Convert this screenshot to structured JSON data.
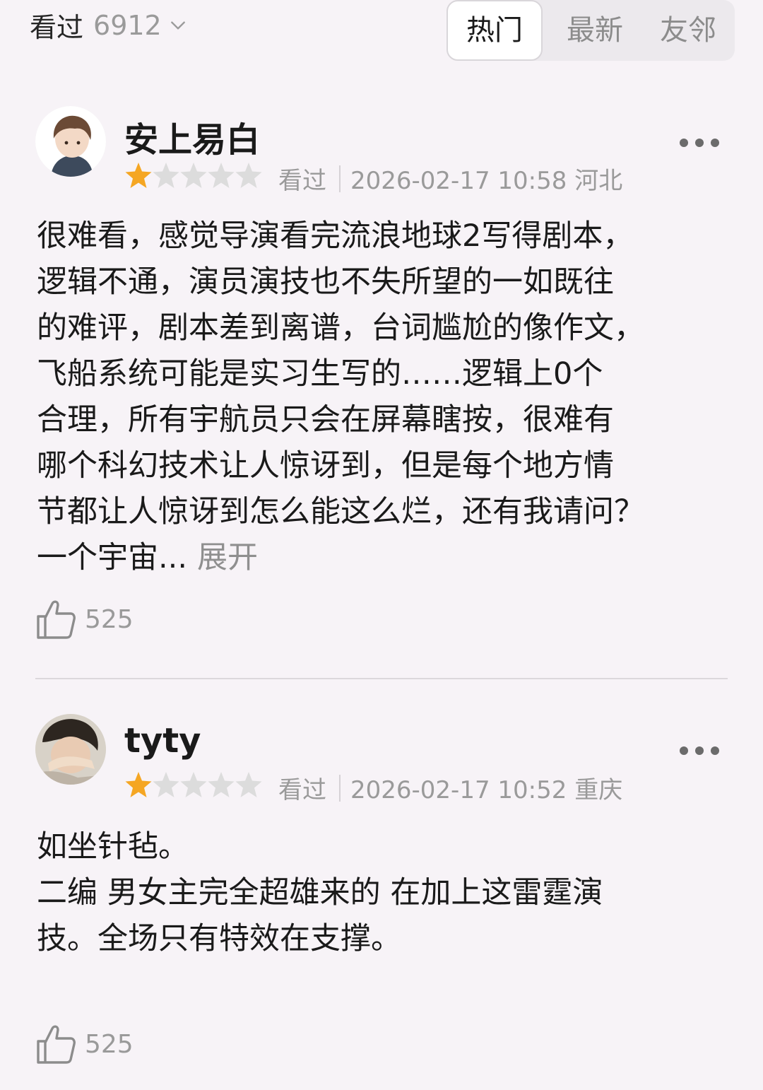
{
  "header": {
    "seen_label": "看过",
    "seen_count": "6912",
    "tabs": [
      {
        "label": "热门",
        "active": true
      },
      {
        "label": "最新",
        "active": false
      },
      {
        "label": "友邻",
        "active": false
      }
    ]
  },
  "reviews": [
    {
      "username": "安上易白",
      "rating": 1,
      "rating_max": 5,
      "status": "看过",
      "datetime_location": "2026-02-17 10:58 河北",
      "text": "很难看，感觉导演看完流浪地球2写得剧本，\n逻辑不通，演员演技也不失所望的一如既往\n的难评，剧本差到离谱，台词尴尬的像作文，\n飞船系统可能是实习生写的……逻辑上0个\n合理，所有宇航员只会在屏幕瞎按，很难有\n哪个科幻技术让人惊讶到，但是每个地方情\n节都让人惊讶到怎么能这么烂，还有我请问？\n一个宇宙...",
      "expand_label": "展开",
      "likes": "525"
    },
    {
      "username": "tyty",
      "rating": 1,
      "rating_max": 5,
      "status": "看过",
      "datetime_location": "2026-02-17 10:52 重庆",
      "text": "如坐针毡。\n二编 男女主完全超雄来的 在加上这雷霆演\n技。全场只有特效在支撑。",
      "likes": "525"
    }
  ],
  "colors": {
    "background": "#f7f3f7",
    "star_filled": "#f5a623",
    "star_empty": "#dcdcdc",
    "muted_text": "#9a9a9a"
  }
}
